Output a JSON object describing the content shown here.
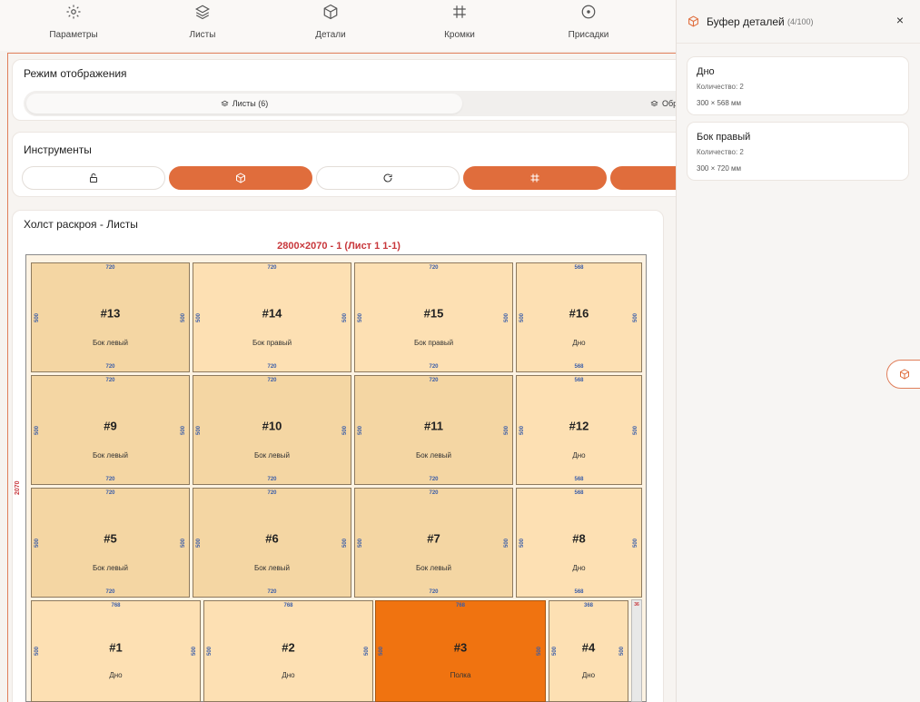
{
  "nav": [
    {
      "label": "Параметры",
      "icon": "gear-icon"
    },
    {
      "label": "Листы",
      "icon": "layers-icon"
    },
    {
      "label": "Детали",
      "icon": "box-icon"
    },
    {
      "label": "Кромки",
      "icon": "hash-icon"
    },
    {
      "label": "Присадки",
      "icon": "target-icon"
    }
  ],
  "display_mode": {
    "title": "Режим отображения",
    "options": [
      {
        "label": "Листы (6)",
        "icon": "layers-icon",
        "active": true
      },
      {
        "label": "Обр",
        "icon": "layers-icon",
        "active": false
      }
    ]
  },
  "tools": {
    "title": "Инструменты",
    "buttons": [
      {
        "icon": "unlock-icon",
        "active": false
      },
      {
        "icon": "box-icon",
        "active": true
      },
      {
        "icon": "rotate-icon",
        "active": false
      },
      {
        "icon": "hash-icon",
        "active": true
      },
      {
        "icon": "extra-icon",
        "active": true
      }
    ]
  },
  "canvas": {
    "title": "Холст раскроя - Листы",
    "sheet_title": "2800×2070 - 1 (Лист 1 1-1)",
    "height_label": "2070",
    "parts": [
      {
        "num": "#13",
        "name": "Бок левый",
        "w": "720",
        "h": "500",
        "dark": true
      },
      {
        "num": "#14",
        "name": "Бок правый",
        "w": "720",
        "h": "500",
        "dark": false
      },
      {
        "num": "#15",
        "name": "Бок правый",
        "w": "720",
        "h": "500",
        "dark": false
      },
      {
        "num": "#16",
        "name": "Дно",
        "w": "568",
        "h": "500",
        "dark": false
      },
      {
        "num": "#9",
        "name": "Бок левый",
        "w": "720",
        "h": "500",
        "dark": true
      },
      {
        "num": "#10",
        "name": "Бок левый",
        "w": "720",
        "h": "500",
        "dark": true
      },
      {
        "num": "#11",
        "name": "Бок левый",
        "w": "720",
        "h": "500",
        "dark": true
      },
      {
        "num": "#12",
        "name": "Дно",
        "w": "568",
        "h": "500",
        "dark": false
      },
      {
        "num": "#5",
        "name": "Бок левый",
        "w": "720",
        "h": "500",
        "dark": true
      },
      {
        "num": "#6",
        "name": "Бок левый",
        "w": "720",
        "h": "500",
        "dark": true
      },
      {
        "num": "#7",
        "name": "Бок левый",
        "w": "720",
        "h": "500",
        "dark": true
      },
      {
        "num": "#8",
        "name": "Дно",
        "w": "568",
        "h": "500",
        "dark": false
      },
      {
        "num": "#1",
        "name": "Дно",
        "w": "768",
        "h": "500",
        "dark": false
      },
      {
        "num": "#2",
        "name": "Дно",
        "w": "768",
        "h": "500",
        "dark": false
      },
      {
        "num": "#3",
        "name": "Полка",
        "w": "768",
        "h": "500",
        "selected": true
      },
      {
        "num": "#4",
        "name": "Дно",
        "w": "368",
        "h": "500",
        "dark": false
      }
    ],
    "waste": {
      "w": "36",
      "h": "500"
    }
  },
  "buffer": {
    "title": "Буфер деталей",
    "count": "(4/100)",
    "close": "×",
    "items": [
      {
        "name": "Дно",
        "qty": "Количество: 2",
        "size": "300 × 568 мм"
      },
      {
        "name": "Бок правый",
        "qty": "Количество: 2",
        "size": "300 × 720 мм"
      }
    ]
  },
  "colors": {
    "accent": "#e06d3c",
    "part": "#fde0b3",
    "part_dark": "#f4d6a3",
    "selected": "#f07310",
    "dim": "#3a5da8",
    "sheet_label": "#c8373b"
  }
}
